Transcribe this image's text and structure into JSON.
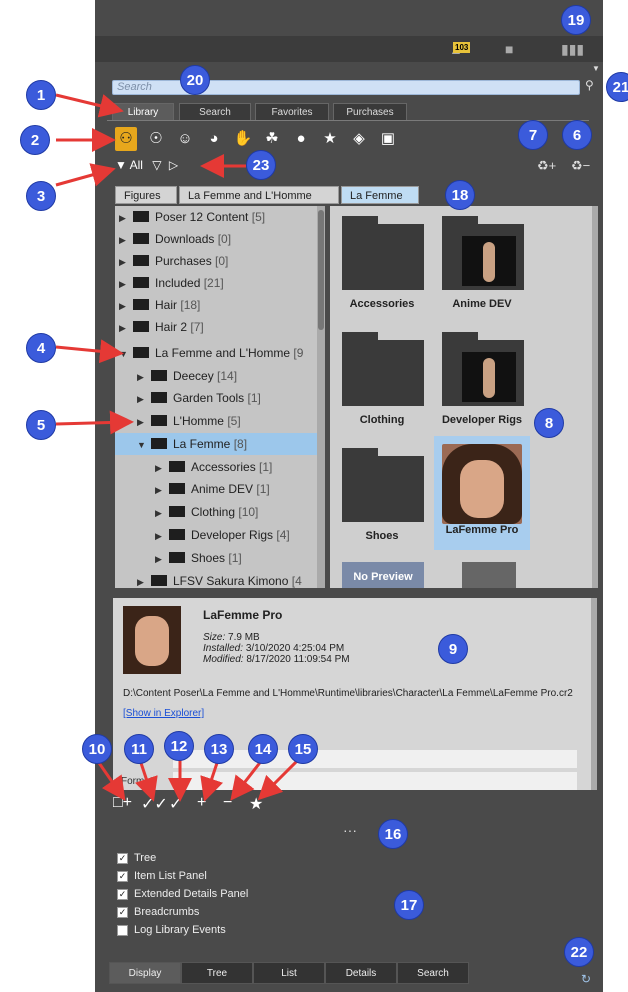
{
  "topbar": {
    "badge": "103"
  },
  "search": {
    "placeholder": "Search"
  },
  "tabs": [
    "Library",
    "Search",
    "Favorites",
    "Purchases"
  ],
  "filter": {
    "label": "All"
  },
  "breadcrumbs": [
    "Figures",
    "La Femme and L'Homme",
    "La Femme"
  ],
  "tree": [
    {
      "name": "Poser 12 Content",
      "count": "[5]"
    },
    {
      "name": "Downloads",
      "count": "[0]"
    },
    {
      "name": "Purchases",
      "count": "[0]"
    },
    {
      "name": "Included",
      "count": "[21]"
    },
    {
      "name": "Hair",
      "count": "[18]"
    },
    {
      "name": "Hair 2",
      "count": "[7]"
    },
    {
      "name": "La Femme and L'Homme",
      "count": "[9"
    },
    {
      "name": "Deecey",
      "count": "[14]"
    },
    {
      "name": "Garden Tools",
      "count": "[1]"
    },
    {
      "name": "L'Homme",
      "count": "[5]"
    },
    {
      "name": "La Femme",
      "count": "[8]"
    },
    {
      "name": "Accessories",
      "count": "[1]"
    },
    {
      "name": "Anime DEV",
      "count": "[1]"
    },
    {
      "name": "Clothing",
      "count": "[10]"
    },
    {
      "name": "Developer Rigs",
      "count": "[4]"
    },
    {
      "name": "Shoes",
      "count": "[1]"
    },
    {
      "name": "LFSV Sakura Kimono",
      "count": "[4"
    }
  ],
  "grid": [
    "Accessories",
    "Anime DEV",
    "Clothing",
    "Developer Rigs",
    "Shoes",
    "LaFemme Pro",
    "No Preview"
  ],
  "details": {
    "title": "LaFemme Pro",
    "size_label": "Size:",
    "size": "7.9 MB",
    "installed_label": "Installed:",
    "installed": "3/10/2020 4:25:04 PM",
    "modified_label": "Modified:",
    "modified": "8/17/2020 11:09:54 PM",
    "path": "D:\\Content Poser\\La Femme and L'Homme\\Runtime\\libraries\\Character\\La Femme\\LaFemme Pro.cr2",
    "show_link": "[Show in Explorer]",
    "field_label": "Format"
  },
  "options": [
    {
      "label": "Tree",
      "checked": true
    },
    {
      "label": "Item List Panel",
      "checked": true
    },
    {
      "label": "Extended Details Panel",
      "checked": true
    },
    {
      "label": "Breadcrumbs",
      "checked": true
    },
    {
      "label": "Log Library Events",
      "checked": false
    }
  ],
  "bottom_tabs": [
    "Display",
    "Tree",
    "List",
    "Details",
    "Search"
  ],
  "callouts": [
    "1",
    "2",
    "3",
    "4",
    "5",
    "6",
    "7",
    "8",
    "9",
    "10",
    "11",
    "12",
    "13",
    "14",
    "15",
    "16",
    "17",
    "18",
    "19",
    "20",
    "21",
    "22",
    "23"
  ]
}
